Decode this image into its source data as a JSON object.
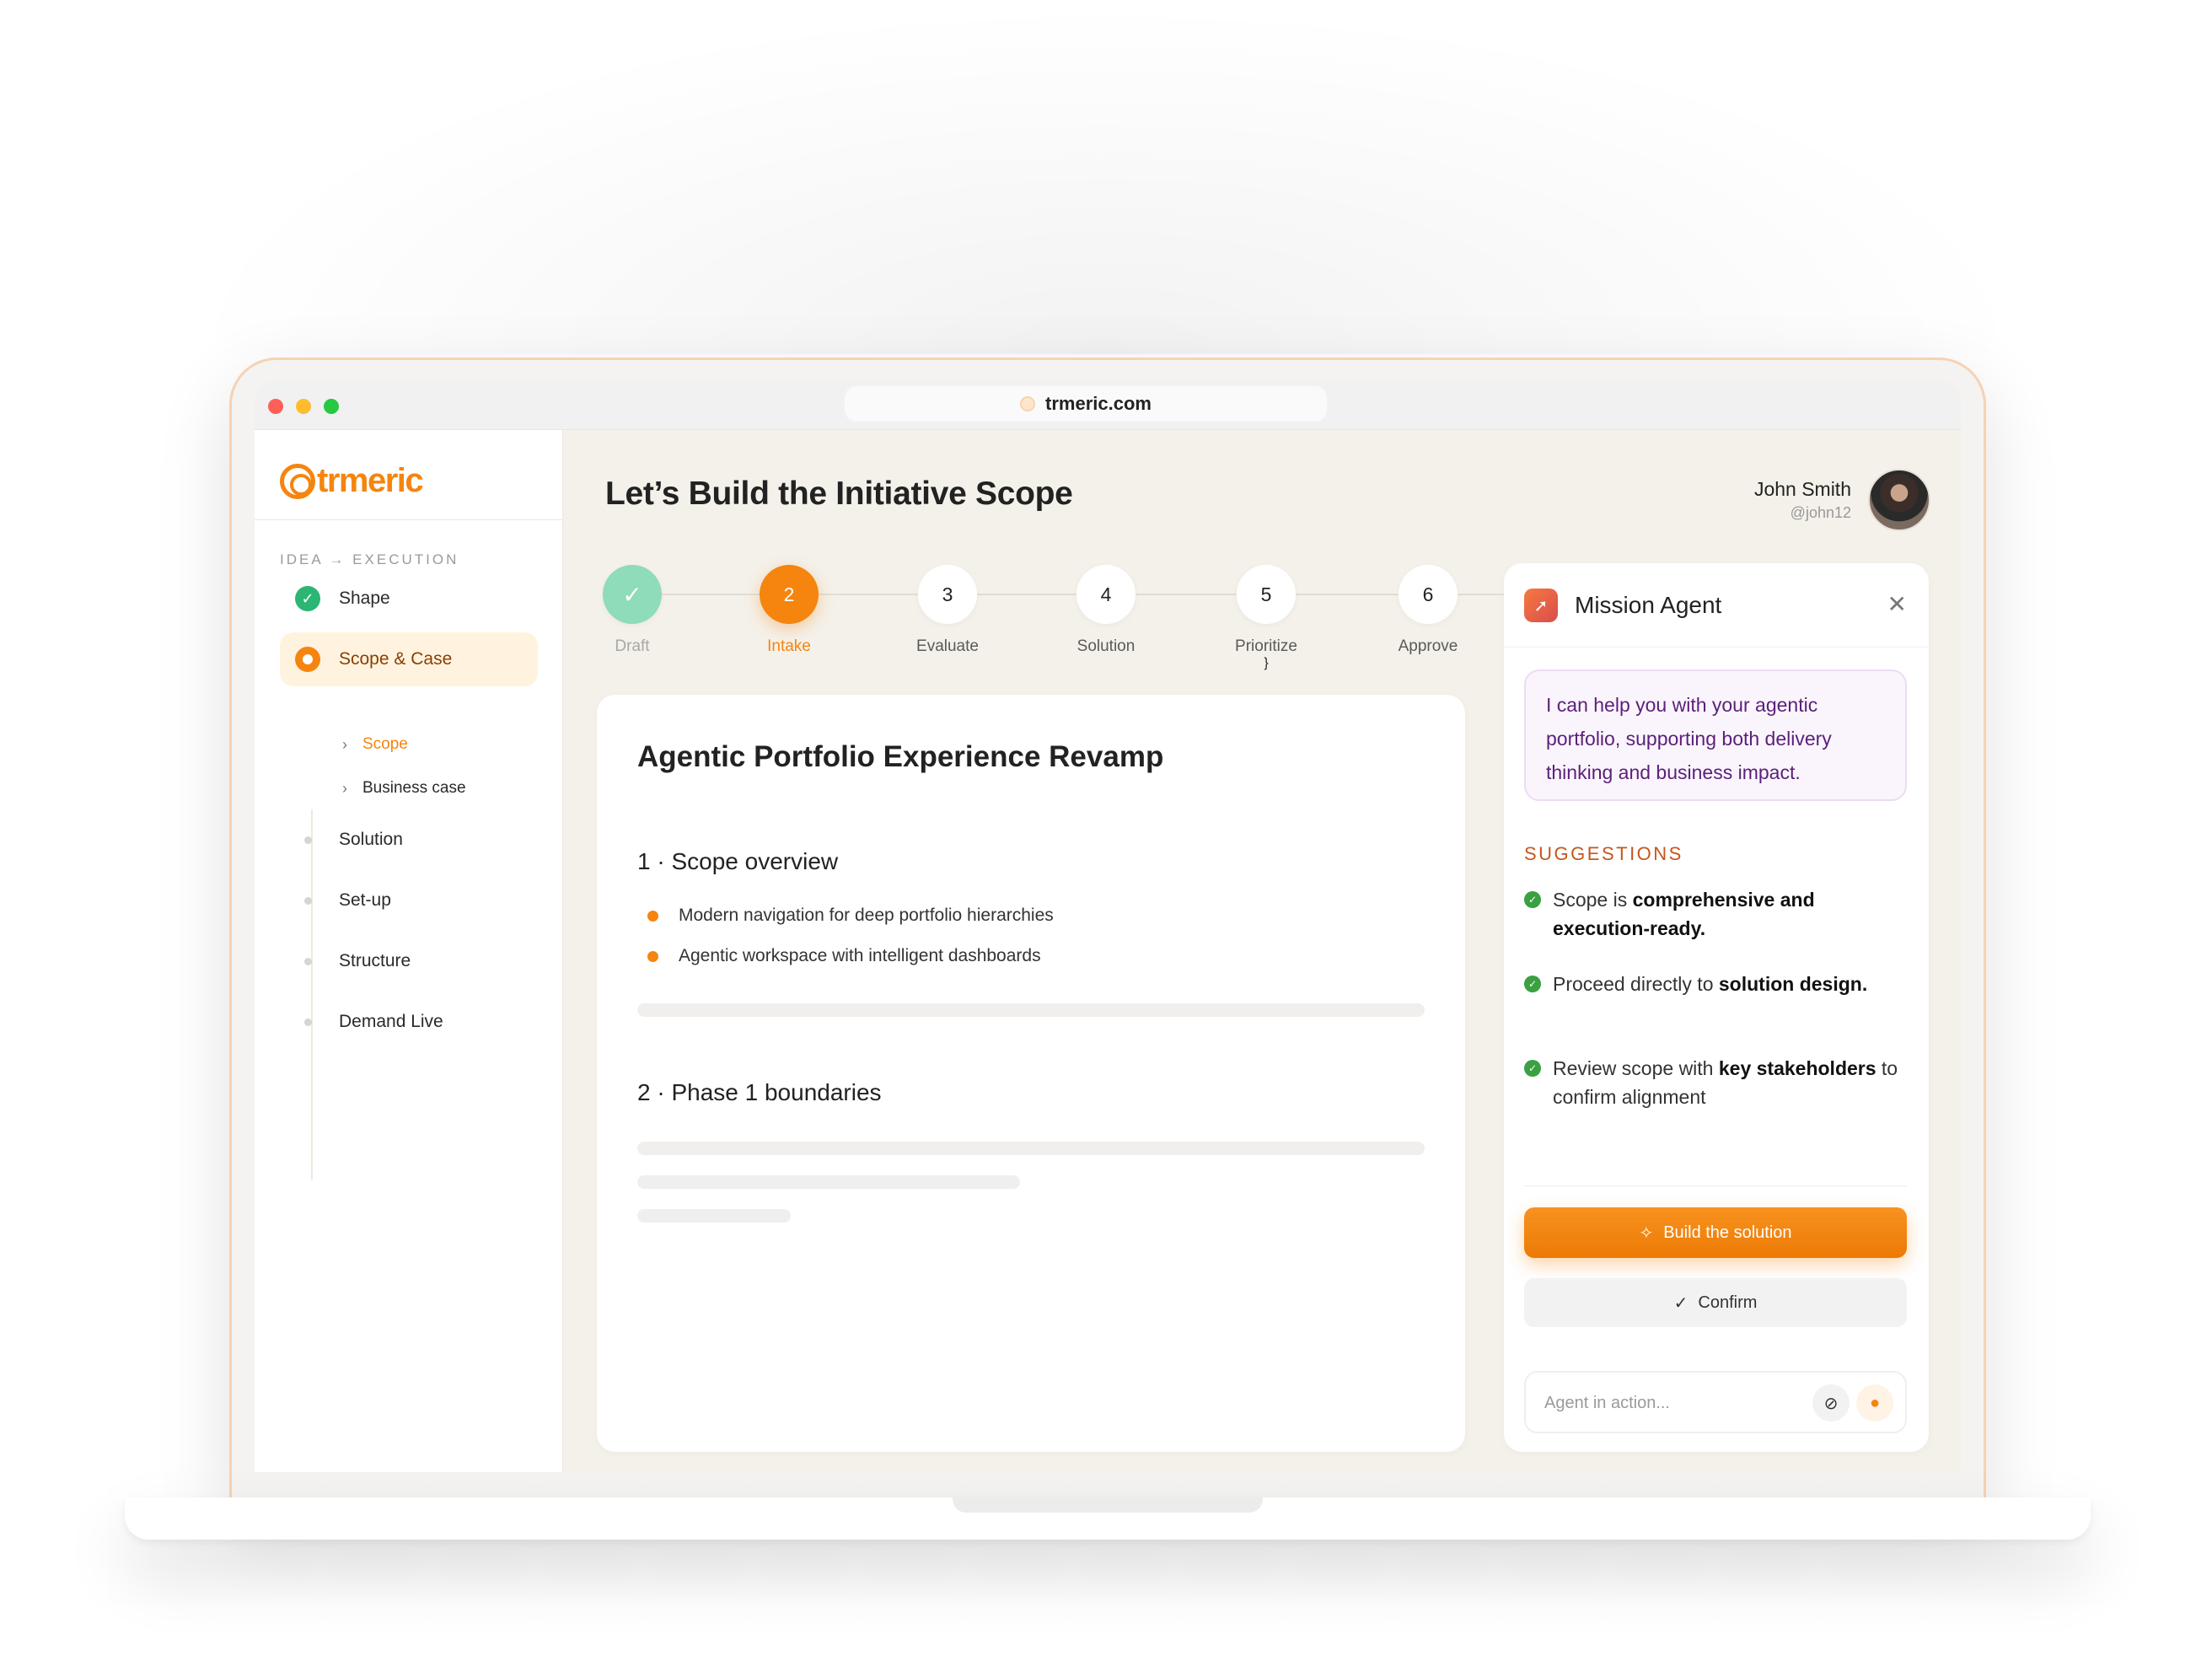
{
  "browser": {
    "url": "trmeric.com"
  },
  "sidebar": {
    "logo": "trmeric",
    "breadcrumb": "IDEA → EXECUTION",
    "items": [
      {
        "label": "Shape",
        "state": "done"
      },
      {
        "label": "Scope & Case",
        "state": "active"
      },
      {
        "label": "Solution",
        "state": "pending"
      },
      {
        "label": "Set-up",
        "state": "pending"
      },
      {
        "label": "Structure",
        "state": "pending"
      },
      {
        "label": "Demand Live",
        "state": "pending"
      }
    ],
    "sub_items": [
      {
        "label": "Scope",
        "active": true
      },
      {
        "label": "Business case",
        "active": false
      }
    ]
  },
  "header": {
    "title": "Let’s Build the Initiative Scope",
    "user_name": "John Smith",
    "user_handle": "@john12"
  },
  "stepper": [
    {
      "number": "✓",
      "label": "Draft",
      "state": "done"
    },
    {
      "number": "2",
      "label": "Intake",
      "state": "current"
    },
    {
      "number": "3",
      "label": "Evaluate",
      "state": "upcoming"
    },
    {
      "number": "4",
      "label": "Solution",
      "state": "upcoming"
    },
    {
      "number": "5",
      "label": "Prioritize",
      "state": "upcoming"
    },
    {
      "number": "6",
      "label": "Approve",
      "state": "upcoming"
    }
  ],
  "card": {
    "title": "Agentic Portfolio Experience Revamp",
    "section1_title": "1 · Scope overview",
    "bullets": [
      "Modern navigation for deep portfolio hierarchies",
      "Agentic workspace with intelligent dashboards"
    ],
    "section2_title": "2 · Phase 1 boundaries"
  },
  "agent": {
    "title": "Mission Agent",
    "message": "I can help you with your agentic portfolio, supporting both delivery thinking and business impact.",
    "suggestions_title": "SUGGESTIONS",
    "suggestions": [
      {
        "pre": "Scope is ",
        "bold": "comprehensive and execution-ready.",
        "post": ""
      },
      {
        "pre": "Proceed directly to ",
        "bold": "solution design.",
        "post": ""
      },
      {
        "pre": "Review scope with ",
        "bold": "key stakeholders",
        "post": " to confirm alignment"
      }
    ],
    "primary_button": "Build the solution",
    "secondary_button": "Confirm",
    "input_placeholder": "Agent in action..."
  },
  "colors": {
    "accent": "#f5850f",
    "success": "#2bb673",
    "agent_text": "#5b1f7a"
  }
}
